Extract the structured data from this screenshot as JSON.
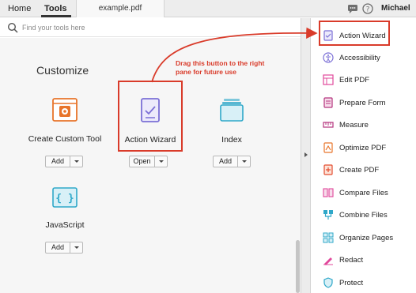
{
  "topbar": {
    "tabs": [
      {
        "label": "Home"
      },
      {
        "label": "Tools"
      }
    ],
    "document_tab": "example.pdf",
    "username": "Michael"
  },
  "search": {
    "placeholder": "Find your tools here"
  },
  "customize": {
    "title": "Customize",
    "tools": [
      {
        "label": "Create Custom Tool",
        "button": "Add",
        "icon": "gear-icon"
      },
      {
        "label": "Action Wizard",
        "button": "Open",
        "icon": "checklist-icon"
      },
      {
        "label": "Index",
        "button": "Add",
        "icon": "folder-stack-icon"
      },
      {
        "label": "JavaScript",
        "button": "Add",
        "icon": "braces-icon"
      }
    ]
  },
  "annotation": {
    "text": "Drag this button to the right pane for future use"
  },
  "right_pane": {
    "items": [
      {
        "label": "Action Wizard",
        "icon": "checklist-icon"
      },
      {
        "label": "Accessibility",
        "icon": "accessibility-icon"
      },
      {
        "label": "Edit PDF",
        "icon": "edit-pdf-icon"
      },
      {
        "label": "Prepare Form",
        "icon": "form-icon"
      },
      {
        "label": "Measure",
        "icon": "ruler-icon"
      },
      {
        "label": "Optimize PDF",
        "icon": "optimize-icon"
      },
      {
        "label": "Create PDF",
        "icon": "create-pdf-icon"
      },
      {
        "label": "Compare Files",
        "icon": "compare-icon"
      },
      {
        "label": "Combine Files",
        "icon": "combine-icon"
      },
      {
        "label": "Organize Pages",
        "icon": "organize-icon"
      },
      {
        "label": "Redact",
        "icon": "redact-icon"
      },
      {
        "label": "Protect",
        "icon": "shield-icon"
      }
    ]
  },
  "colors": {
    "highlight": "#d93b2a",
    "accent_orange": "#e8742a",
    "accent_purple": "#7b6fd6",
    "accent_teal": "#2fa8c9"
  }
}
